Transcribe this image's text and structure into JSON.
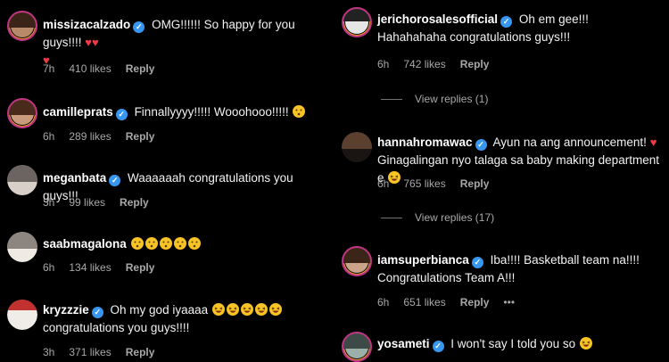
{
  "colors": {
    "badge": "#3797f0",
    "heart": "#ed3b48",
    "meta": "#a8a8a8",
    "ring": "#c13584"
  },
  "left": [
    {
      "username": "missizacalzado",
      "text": "OMG!!!!!! So happy for you guys!!!!",
      "time": "7h",
      "likes": "410 likes",
      "reply": "Reply"
    },
    {
      "username": "camilleprats",
      "text": "Finnallyyyy!!!!! Wooohooo!!!!!",
      "time": "6h",
      "likes": "289 likes",
      "reply": "Reply"
    },
    {
      "username": "meganbata",
      "text": "Waaaaaah congratulations you guys!!!",
      "time": "3h",
      "likes": "99 likes",
      "reply": "Reply"
    },
    {
      "username": "saabmagalona",
      "text": "",
      "time": "6h",
      "likes": "134 likes",
      "reply": "Reply"
    },
    {
      "username": "kryzzzie",
      "text": "Oh my god iyaaaa",
      "text_after": "congratulations you guys!!!!",
      "time": "3h",
      "likes": "371 likes",
      "reply": "Reply"
    }
  ],
  "right": [
    {
      "username": "jerichorosalesofficial",
      "text": "Oh em gee!!! Hahahahaha congratulations guys!!!",
      "time": "6h",
      "likes": "742 likes",
      "reply": "Reply",
      "view_replies": "View replies (1)"
    },
    {
      "username": "hannahromawac",
      "text": "Ayun na ang announcement!",
      "text_after": "Ginagalingan nyo talaga sa baby making department e",
      "time": "6h",
      "likes": "765 likes",
      "reply": "Reply",
      "view_replies": "View replies (17)"
    },
    {
      "username": "iamsuperbianca",
      "text": "Iba!!!! Basketball team na!!!! Congratulations Team A!!!",
      "time": "6h",
      "likes": "651 likes",
      "reply": "Reply",
      "more": "•••"
    },
    {
      "username": "yosameti",
      "text": "I won't say I told you so"
    }
  ]
}
